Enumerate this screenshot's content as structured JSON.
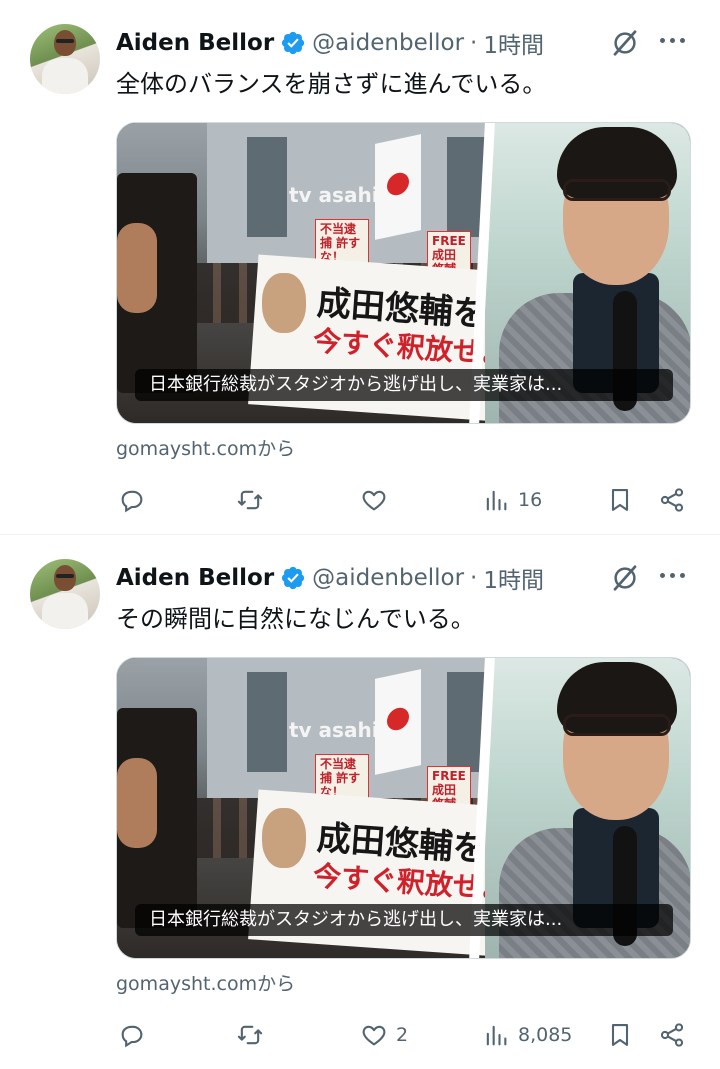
{
  "colors": {
    "text_primary": "#0f1419",
    "text_secondary": "#536471",
    "verified_blue": "#1d9bf0",
    "divider": "#eff3f4"
  },
  "tweets": [
    {
      "author_name": "Aiden Bellor",
      "handle": "@aidenbellor",
      "separator": "·",
      "time": "1時間",
      "text": "全体のバランスを崩さずに進んでいる。",
      "card": {
        "logo_text": "tv asahi",
        "sign1": "不当逮捕 許すな！",
        "sign2": "FREE 成田悠輔",
        "banner_line1": "成田悠輔を",
        "banner_line2": "今すぐ釈放せよ！",
        "caption": "日本銀行総裁がスタジオから逃げ出し、実業家は..."
      },
      "source": "gomaysht.comから",
      "stats": {
        "replies": "",
        "retweets": "",
        "likes": "",
        "views": "16"
      },
      "icons": [
        "reply-icon",
        "retweet-icon",
        "like-icon",
        "views-icon",
        "bookmark-icon",
        "share-icon"
      ]
    },
    {
      "author_name": "Aiden Bellor",
      "handle": "@aidenbellor",
      "separator": "·",
      "time": "1時間",
      "text": "その瞬間に自然になじんでいる。",
      "card": {
        "logo_text": "tv asahi",
        "sign1": "不当逮捕 許すな！",
        "sign2": "FREE 成田悠輔",
        "banner_line1": "成田悠輔を",
        "banner_line2": "今すぐ釈放せよ！",
        "caption": "日本銀行総裁がスタジオから逃げ出し、実業家は..."
      },
      "source": "gomaysht.comから",
      "stats": {
        "replies": "",
        "retweets": "",
        "likes": "2",
        "views": "8,085"
      },
      "icons": [
        "reply-icon",
        "retweet-icon",
        "like-icon",
        "views-icon",
        "bookmark-icon",
        "share-icon"
      ]
    }
  ]
}
